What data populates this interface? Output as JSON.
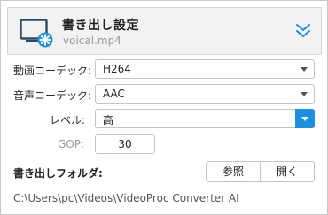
{
  "header": {
    "title": "書き出し設定",
    "filename": "voical.mp4",
    "icon": "monitor-settings-icon",
    "collapse_icon": "double-chevron-down-icon",
    "accent_color": "#1e8fe0"
  },
  "form": {
    "video_codec": {
      "label": "動画コーデック:",
      "value": "H264"
    },
    "audio_codec": {
      "label": "音声コーデック:",
      "value": "AAC"
    },
    "level": {
      "label": "レベル:",
      "value": "高"
    },
    "gop": {
      "label": "GOP:",
      "value": "30"
    }
  },
  "output": {
    "label": "書き出しフォルダ:",
    "browse_label": "参照",
    "open_label": "開く",
    "path": "C:\\Users\\pc\\Videos\\VideoProc Converter AI"
  }
}
